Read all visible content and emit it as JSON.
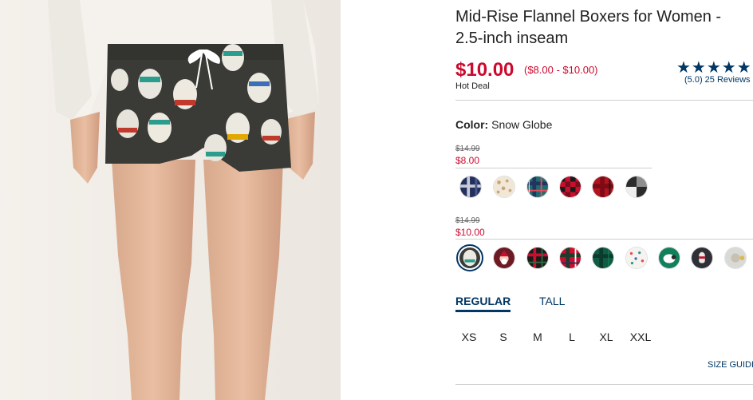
{
  "product": {
    "title": "Mid-Rise Flannel Boxers for Women - 2.5-inch inseam",
    "price": "$10.00",
    "price_range": "($8.00 - $10.00)",
    "badge": "Hot Deal",
    "rating_stars": "★★★★★",
    "reviews": "(5.0) 25 Reviews"
  },
  "color": {
    "label": "Color:",
    "value": "Snow Globe"
  },
  "groups": [
    {
      "old_price": "$14.99",
      "sale_price": "$8.00",
      "swatches": [
        "navy-plaid",
        "leopard-print",
        "teal-tartan",
        "red-buffalo-check",
        "red-plaid",
        "black-white-check"
      ]
    },
    {
      "old_price": "$14.99",
      "sale_price": "$10.00",
      "swatches": [
        "snow-globe",
        "santa-print",
        "black-red-tartan",
        "red-tartan",
        "green-tartan",
        "polka-dot",
        "sheep-print",
        "llama-print",
        "gray-print"
      ]
    }
  ],
  "fit_tabs": [
    "REGULAR",
    "TALL"
  ],
  "sizes": [
    "XS",
    "S",
    "M",
    "L",
    "XL",
    "XXL"
  ],
  "size_guide": "SIZE GUIDE",
  "colors": {
    "accent": "#003764",
    "sale_red": "#cc0a2f"
  }
}
